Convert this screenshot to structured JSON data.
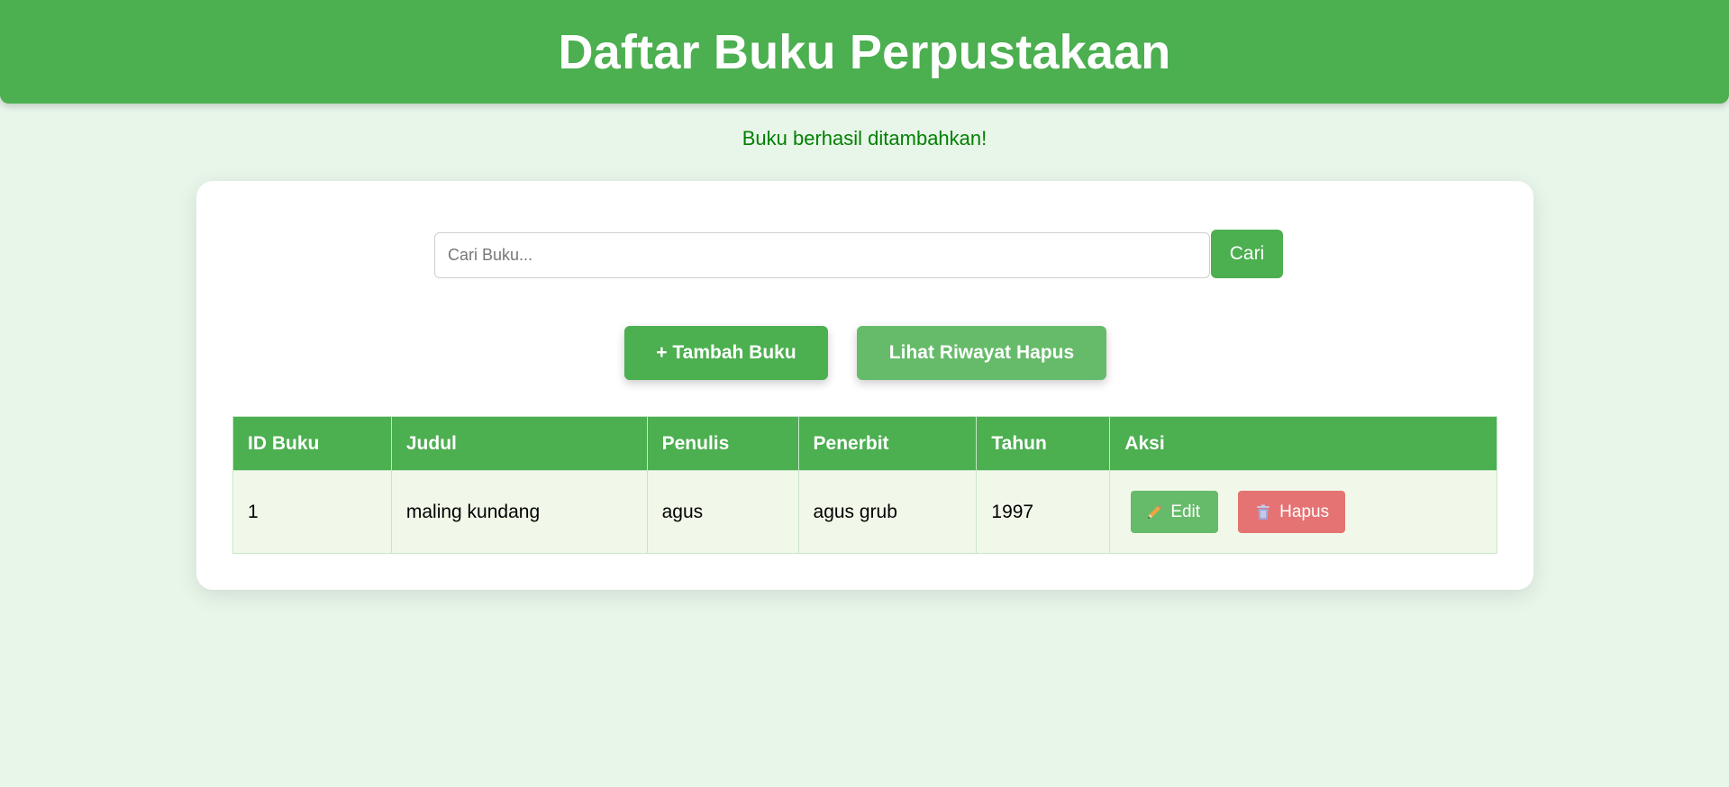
{
  "header": {
    "title": "Daftar Buku Perpustakaan"
  },
  "flash": {
    "message": "Buku berhasil ditambahkan!"
  },
  "search": {
    "placeholder": "Cari Buku...",
    "value": "",
    "button_label": "Cari"
  },
  "actions": {
    "add_label": "+ Tambah Buku",
    "history_label": "Lihat Riwayat Hapus"
  },
  "table": {
    "columns": [
      "ID Buku",
      "Judul",
      "Penulis",
      "Penerbit",
      "Tahun",
      "Aksi"
    ],
    "rows": [
      {
        "id": "1",
        "judul": "maling kundang",
        "penulis": "agus",
        "penerbit": "agus grub",
        "tahun": "1997",
        "edit_label": "Edit",
        "edit_icon": "pencil-icon",
        "delete_label": "Hapus",
        "delete_icon": "trash-icon"
      }
    ]
  },
  "colors": {
    "primary": "#4caf50",
    "secondary": "#66bb6a",
    "danger": "#e57373",
    "background": "#e8f5e9",
    "success_text": "#008000"
  }
}
